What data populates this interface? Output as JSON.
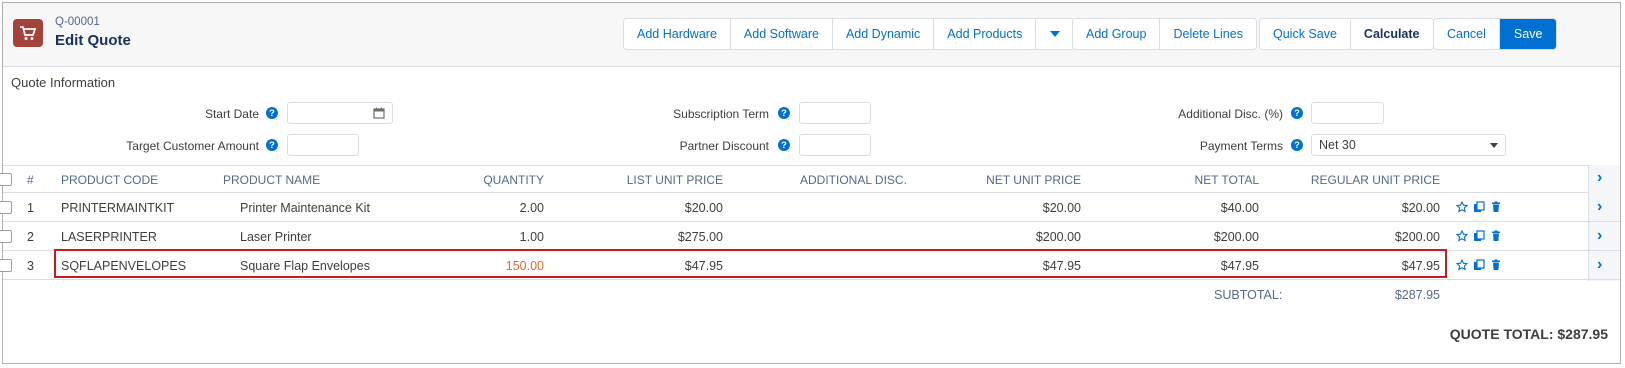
{
  "header": {
    "quote_number": "Q-00001",
    "title": "Edit Quote",
    "buttons": {
      "add_hardware": "Add Hardware",
      "add_software": "Add Software",
      "add_dynamic": "Add Dynamic",
      "add_products": "Add Products",
      "add_group": "Add Group",
      "delete_lines": "Delete Lines",
      "quick_save": "Quick Save",
      "calculate": "Calculate",
      "cancel": "Cancel",
      "save": "Save"
    }
  },
  "quote_info": {
    "section_label": "Quote Information",
    "start_date_label": "Start Date",
    "start_date_value": "",
    "target_customer_amount_label": "Target Customer Amount",
    "target_customer_amount_value": "",
    "subscription_term_label": "Subscription Term",
    "subscription_term_value": "",
    "partner_discount_label": "Partner Discount",
    "partner_discount_value": "",
    "additional_disc_label": "Additional Disc. (%)",
    "additional_disc_value": "",
    "payment_terms_label": "Payment Terms",
    "payment_terms_value": "Net 30"
  },
  "table": {
    "columns": {
      "num": "#",
      "product_code": "PRODUCT CODE",
      "product_name": "PRODUCT NAME",
      "quantity": "QUANTITY",
      "list_unit_price": "LIST UNIT PRICE",
      "additional_disc": "ADDITIONAL DISC.",
      "net_unit_price": "NET UNIT PRICE",
      "net_total": "NET TOTAL",
      "regular_unit_price": "REGULAR UNIT PRICE"
    },
    "rows": [
      {
        "num": "1",
        "product_code": "PRINTERMAINTKIT",
        "product_name": "Printer Maintenance Kit",
        "quantity": "2.00",
        "list_unit_price": "$20.00",
        "additional_disc": "",
        "net_unit_price": "$20.00",
        "net_total": "$40.00",
        "regular_unit_price": "$20.00"
      },
      {
        "num": "2",
        "product_code": "LASERPRINTER",
        "product_name": "Laser Printer",
        "quantity": "1.00",
        "list_unit_price": "$275.00",
        "additional_disc": "",
        "net_unit_price": "$200.00",
        "net_total": "$200.00",
        "regular_unit_price": "$200.00"
      },
      {
        "num": "3",
        "product_code": "SQFLAPENVELOPES",
        "product_name": "Square Flap Envelopes",
        "quantity": "150.00",
        "list_unit_price": "$47.95",
        "additional_disc": "",
        "net_unit_price": "$47.95",
        "net_total": "$47.95",
        "regular_unit_price": "$47.95"
      }
    ],
    "subtotal_label": "SUBTOTAL:",
    "subtotal_value": "$287.95",
    "quote_total": "QUOTE TOTAL: $287.95"
  },
  "colors": {
    "brand_blue": "#0070d2",
    "icon_red": "#a3433c",
    "highlight_red": "#d0161b",
    "quantity_orange": "#e8682a"
  },
  "icons": [
    "cart-icon",
    "help-icon",
    "calendar-icon",
    "caret-down-icon",
    "star-icon",
    "clone-icon",
    "trash-icon",
    "chevron-right-icon"
  ]
}
